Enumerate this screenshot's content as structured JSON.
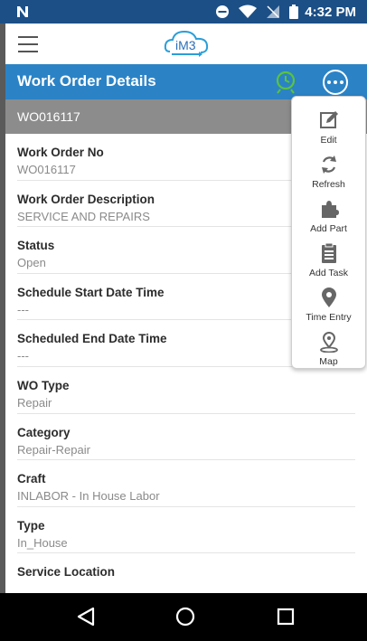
{
  "status_bar": {
    "time": "4:32 PM"
  },
  "app": {
    "logo_text": "iM3",
    "title": "Work Order Details",
    "wo_header": "WO016117",
    "fields": [
      {
        "label": "Work Order No",
        "value": "WO016117"
      },
      {
        "label": "Work Order Description",
        "value": "SERVICE AND REPAIRS"
      },
      {
        "label": "Status",
        "value": "Open"
      },
      {
        "label": "Schedule Start Date Time",
        "value": "---"
      },
      {
        "label": "Scheduled End Date Time",
        "value": "---"
      },
      {
        "label": "WO Type",
        "value": "Repair"
      },
      {
        "label": "Category",
        "value": "Repair-Repair"
      },
      {
        "label": "Craft",
        "value": "INLABOR - In House Labor"
      },
      {
        "label": "Type",
        "value": "In_House"
      },
      {
        "label": "Service Location",
        "value": ""
      }
    ]
  },
  "menu": {
    "items": [
      {
        "label": "Edit",
        "icon": "edit-icon"
      },
      {
        "label": "Refresh",
        "icon": "refresh-icon"
      },
      {
        "label": "Add Part",
        "icon": "puzzle-icon"
      },
      {
        "label": "Add Task",
        "icon": "clipboard-icon"
      },
      {
        "label": "Time Entry",
        "icon": "location-pin-icon"
      },
      {
        "label": "Map",
        "icon": "map-pin-icon"
      }
    ]
  },
  "colors": {
    "title_bar": "#2b83c6",
    "status_bar": "#1c4f86",
    "wo_header": "#8c8c8c",
    "clock_icon": "#5bc43a"
  }
}
